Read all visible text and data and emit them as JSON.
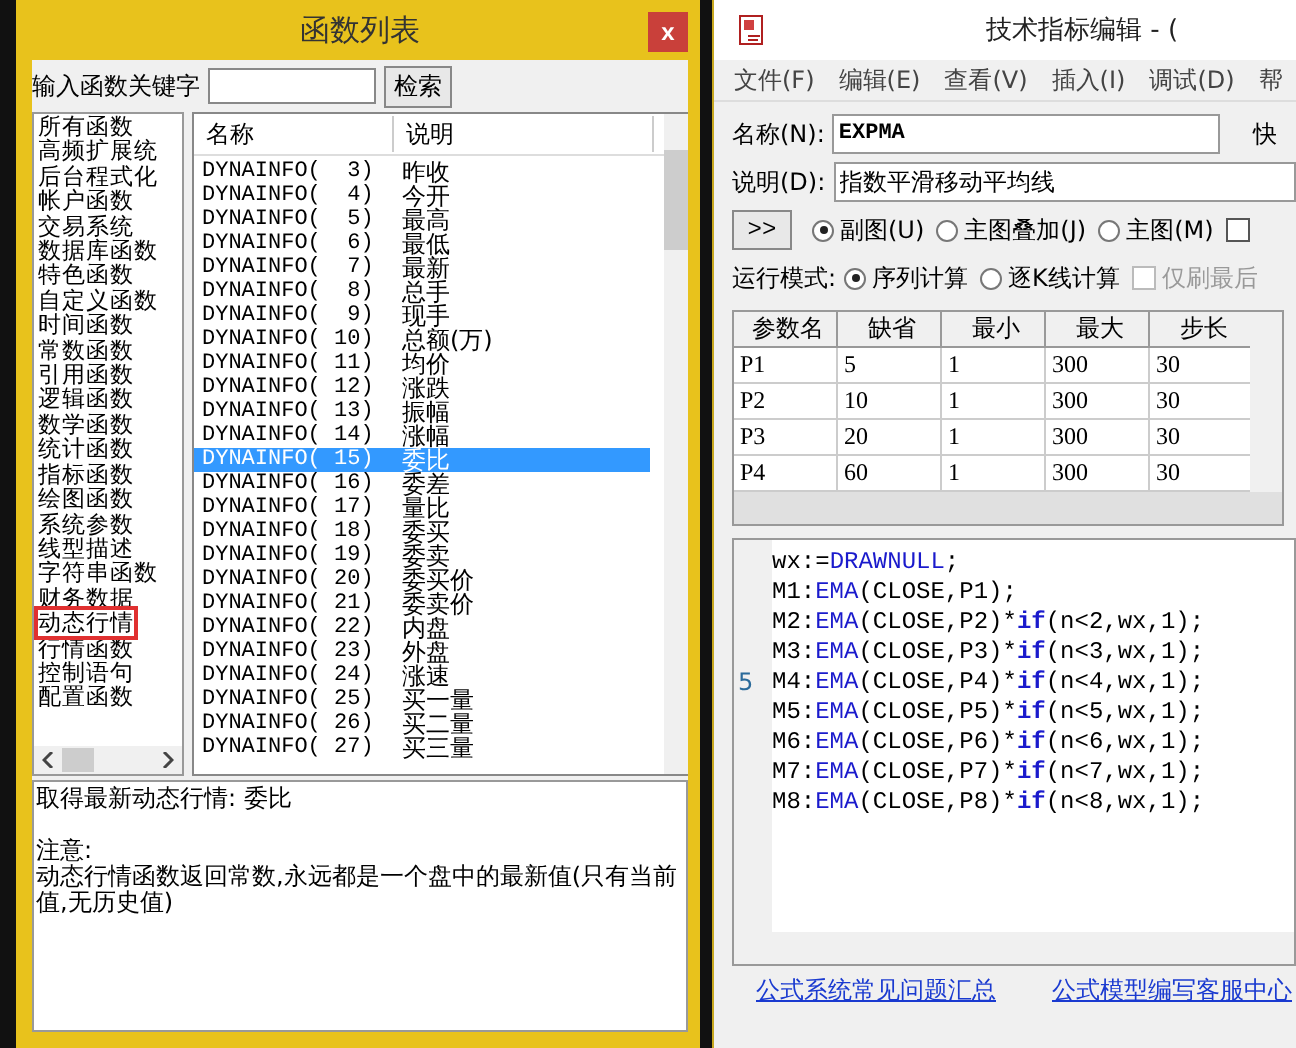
{
  "function_list_window": {
    "title": "函数列表",
    "close": "x",
    "search": {
      "label": "输入函数关键字",
      "button": "检索"
    },
    "categories": [
      {
        "label": "所有函数",
        "selected": false
      },
      {
        "label": "高频扩展统",
        "selected": false
      },
      {
        "label": "后台程式化",
        "selected": false
      },
      {
        "label": "帐户函数",
        "selected": false
      },
      {
        "label": "交易系统",
        "selected": false
      },
      {
        "label": "数据库函数",
        "selected": false
      },
      {
        "label": "特色函数",
        "selected": false
      },
      {
        "label": "自定义函数",
        "selected": false
      },
      {
        "label": "时间函数",
        "selected": false
      },
      {
        "label": "常数函数",
        "selected": false
      },
      {
        "label": "引用函数",
        "selected": false
      },
      {
        "label": "逻辑函数",
        "selected": false
      },
      {
        "label": "数学函数",
        "selected": false
      },
      {
        "label": "统计函数",
        "selected": false
      },
      {
        "label": "指标函数",
        "selected": false
      },
      {
        "label": "绘图函数",
        "selected": false
      },
      {
        "label": "系统参数",
        "selected": false
      },
      {
        "label": "线型描述",
        "selected": false
      },
      {
        "label": "字符串函数",
        "selected": false
      },
      {
        "label": "财务数据",
        "selected": false
      },
      {
        "label": "动态行情",
        "selected": true
      },
      {
        "label": "行情函数",
        "selected": false
      },
      {
        "label": "控制语句",
        "selected": false
      },
      {
        "label": "配置函数",
        "selected": false
      }
    ],
    "columns": [
      "名称",
      "说明"
    ],
    "functions": [
      {
        "name": "DYNAINFO(  3)",
        "desc": "昨收",
        "selected": false
      },
      {
        "name": "DYNAINFO(  4)",
        "desc": "今开",
        "selected": false
      },
      {
        "name": "DYNAINFO(  5)",
        "desc": "最高",
        "selected": false
      },
      {
        "name": "DYNAINFO(  6)",
        "desc": "最低",
        "selected": false
      },
      {
        "name": "DYNAINFO(  7)",
        "desc": "最新",
        "selected": false
      },
      {
        "name": "DYNAINFO(  8)",
        "desc": "总手",
        "selected": false
      },
      {
        "name": "DYNAINFO(  9)",
        "desc": "现手",
        "selected": false
      },
      {
        "name": "DYNAINFO( 10)",
        "desc": "总额(万)",
        "selected": false
      },
      {
        "name": "DYNAINFO( 11)",
        "desc": "均价",
        "selected": false
      },
      {
        "name": "DYNAINFO( 12)",
        "desc": "涨跌",
        "selected": false
      },
      {
        "name": "DYNAINFO( 13)",
        "desc": "振幅",
        "selected": false
      },
      {
        "name": "DYNAINFO( 14)",
        "desc": "涨幅",
        "selected": false
      },
      {
        "name": "DYNAINFO( 15)",
        "desc": "委比",
        "selected": true
      },
      {
        "name": "DYNAINFO( 16)",
        "desc": "委差",
        "selected": false
      },
      {
        "name": "DYNAINFO( 17)",
        "desc": "量比",
        "selected": false
      },
      {
        "name": "DYNAINFO( 18)",
        "desc": "委买",
        "selected": false
      },
      {
        "name": "DYNAINFO( 19)",
        "desc": "委卖",
        "selected": false
      },
      {
        "name": "DYNAINFO( 20)",
        "desc": "委买价",
        "selected": false
      },
      {
        "name": "DYNAINFO( 21)",
        "desc": "委卖价",
        "selected": false
      },
      {
        "name": "DYNAINFO( 22)",
        "desc": "内盘",
        "selected": false
      },
      {
        "name": "DYNAINFO( 23)",
        "desc": "外盘",
        "selected": false
      },
      {
        "name": "DYNAINFO( 24)",
        "desc": "涨速",
        "selected": false
      },
      {
        "name": "DYNAINFO( 25)",
        "desc": "买一量",
        "selected": false
      },
      {
        "name": "DYNAINFO( 26)",
        "desc": "买二量",
        "selected": false
      },
      {
        "name": "DYNAINFO( 27)",
        "desc": "买三量",
        "selected": false
      }
    ],
    "description": {
      "summary": "取得最新动态行情: 委比",
      "note_label": "注意:",
      "note": "动态行情函数返回常数,永远都是一个盘中的最新值(只有当前值,无历史值)"
    }
  },
  "editor_window": {
    "title": "技术指标编辑 - (",
    "menu": [
      "文件(F)",
      "编辑(E)",
      "查看(V)",
      "插入(I)",
      "调试(D)",
      "帮"
    ],
    "name_label": "名称(N):",
    "name_value": "EXPMA",
    "shortcut_label": "快",
    "desc_label": "说明(D):",
    "desc_value": "指数平滑移动平均线",
    "expand_button": ">>",
    "chart_types": [
      {
        "label": "副图(U)",
        "selected": true
      },
      {
        "label": "主图叠加(J)",
        "selected": false
      },
      {
        "label": "主图(M)",
        "selected": false
      }
    ],
    "extra_checkbox": {
      "checked": false
    },
    "mode_label": "运行模式:",
    "modes": [
      {
        "label": "序列计算",
        "selected": true
      },
      {
        "label": "逐K线计算",
        "selected": false
      }
    ],
    "refresh_last": {
      "label": "仅刷最后",
      "checked": false,
      "disabled": true
    },
    "param_columns": [
      "参数名",
      "缺省",
      "最小",
      "最大",
      "步长"
    ],
    "params": [
      [
        "P1",
        "5",
        "1",
        "300",
        "30"
      ],
      [
        "P2",
        "10",
        "1",
        "300",
        "30"
      ],
      [
        "P3",
        "20",
        "1",
        "300",
        "30"
      ],
      [
        "P4",
        "60",
        "1",
        "300",
        "30"
      ]
    ],
    "code_lines": [
      {
        "tokens": [
          {
            "text": "wx:=",
            "kind": "plain"
          },
          {
            "text": "DRAWNULL",
            "kind": "func"
          },
          {
            "text": ";",
            "kind": "plain"
          }
        ]
      },
      {
        "tokens": [
          {
            "text": "M1:",
            "kind": "plain"
          },
          {
            "text": "EMA",
            "kind": "func"
          },
          {
            "text": "(CLOSE,P1);",
            "kind": "plain"
          }
        ]
      },
      {
        "tokens": [
          {
            "text": "M2:",
            "kind": "plain"
          },
          {
            "text": "EMA",
            "kind": "func"
          },
          {
            "text": "(CLOSE,P2)*",
            "kind": "plain"
          },
          {
            "text": "if",
            "kind": "keyword"
          },
          {
            "text": "(n<2,wx,1);",
            "kind": "plain"
          }
        ]
      },
      {
        "tokens": [
          {
            "text": "M3:",
            "kind": "plain"
          },
          {
            "text": "EMA",
            "kind": "func"
          },
          {
            "text": "(CLOSE,P3)*",
            "kind": "plain"
          },
          {
            "text": "if",
            "kind": "keyword"
          },
          {
            "text": "(n<3,wx,1);",
            "kind": "plain"
          }
        ]
      },
      {
        "number": "5",
        "tokens": [
          {
            "text": "M4:",
            "kind": "plain"
          },
          {
            "text": "EMA",
            "kind": "func"
          },
          {
            "text": "(CLOSE,P4)*",
            "kind": "plain"
          },
          {
            "text": "if",
            "kind": "keyword"
          },
          {
            "text": "(n<4,wx,1);",
            "kind": "plain"
          }
        ]
      },
      {
        "tokens": [
          {
            "text": "M5:",
            "kind": "plain"
          },
          {
            "text": "EMA",
            "kind": "func"
          },
          {
            "text": "(CLOSE,P5)*",
            "kind": "plain"
          },
          {
            "text": "if",
            "kind": "keyword"
          },
          {
            "text": "(n<5,wx,1);",
            "kind": "plain"
          }
        ]
      },
      {
        "tokens": [
          {
            "text": "M6:",
            "kind": "plain"
          },
          {
            "text": "EMA",
            "kind": "func"
          },
          {
            "text": "(CLOSE,P6)*",
            "kind": "plain"
          },
          {
            "text": "if",
            "kind": "keyword"
          },
          {
            "text": "(n<6,wx,1);",
            "kind": "plain"
          }
        ]
      },
      {
        "tokens": [
          {
            "text": "M7:",
            "kind": "plain"
          },
          {
            "text": "EMA",
            "kind": "func"
          },
          {
            "text": "(CLOSE,P7)*",
            "kind": "plain"
          },
          {
            "text": "if",
            "kind": "keyword"
          },
          {
            "text": "(n<7,wx,1);",
            "kind": "plain"
          }
        ]
      },
      {
        "tokens": [
          {
            "text": "M8:",
            "kind": "plain"
          },
          {
            "text": "EMA",
            "kind": "func"
          },
          {
            "text": "(CLOSE,P8)*",
            "kind": "plain"
          },
          {
            "text": "if",
            "kind": "keyword"
          },
          {
            "text": "(n<8,wx,1);",
            "kind": "plain"
          }
        ]
      }
    ],
    "links": [
      "公式系统常见问题汇总",
      "公式模型编写客服中心"
    ]
  }
}
